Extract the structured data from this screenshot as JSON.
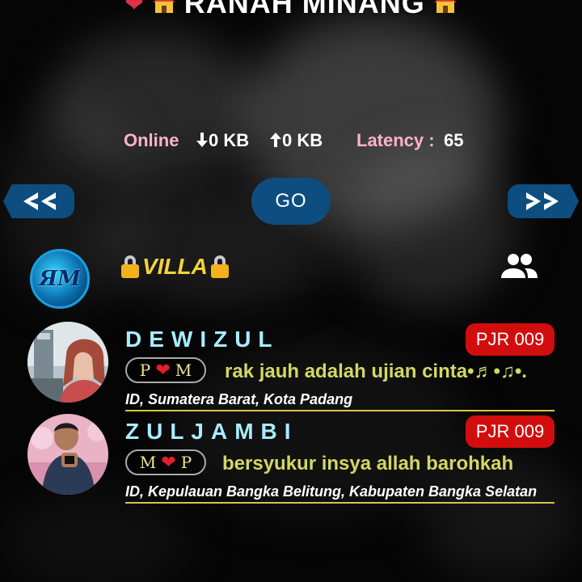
{
  "banner": {
    "title": "RANAH MINANG",
    "left_icons": [
      "heart-icon",
      "house-icon"
    ],
    "right_icons": [
      "house-icon"
    ]
  },
  "status": {
    "online_label": "Online",
    "download": "0 KB",
    "upload": "0 KB",
    "latency_label": "Latency :",
    "latency_value": "65",
    "colors": {
      "label": "#ffb3c7",
      "value": "#ffffff"
    }
  },
  "nav": {
    "prev_icon": "double-chevron-left-icon",
    "go_label": "GO",
    "next_icon": "double-chevron-right-icon",
    "color": "#0e4d80"
  },
  "room": {
    "title": "VILLA",
    "logo_icon": "room-logo",
    "members_icon": "users-icon"
  },
  "users": [
    {
      "name": "DEWIZUL",
      "badge": "PJR 009",
      "pill_left": "P",
      "pill_right": "M",
      "status": "rak jauh adalah ujian cinta•♬•♫•.",
      "location": "ID, Sumatera Barat, Kota Padang"
    },
    {
      "name": "ZULJAMBI",
      "badge": "PJR 009",
      "pill_left": "M",
      "pill_right": "P",
      "status": "bersyukur insya allah barohkah",
      "location": "ID, Kepulauan Bangka Belitung, Kabupaten Bangka Selatan"
    }
  ],
  "colors": {
    "accent": "#0e4d80",
    "badge": "#d20d0d",
    "username": "#a8ecff",
    "status_text": "#d2d862",
    "divider": "#d4c64a",
    "room_title": "#f4d23a"
  }
}
